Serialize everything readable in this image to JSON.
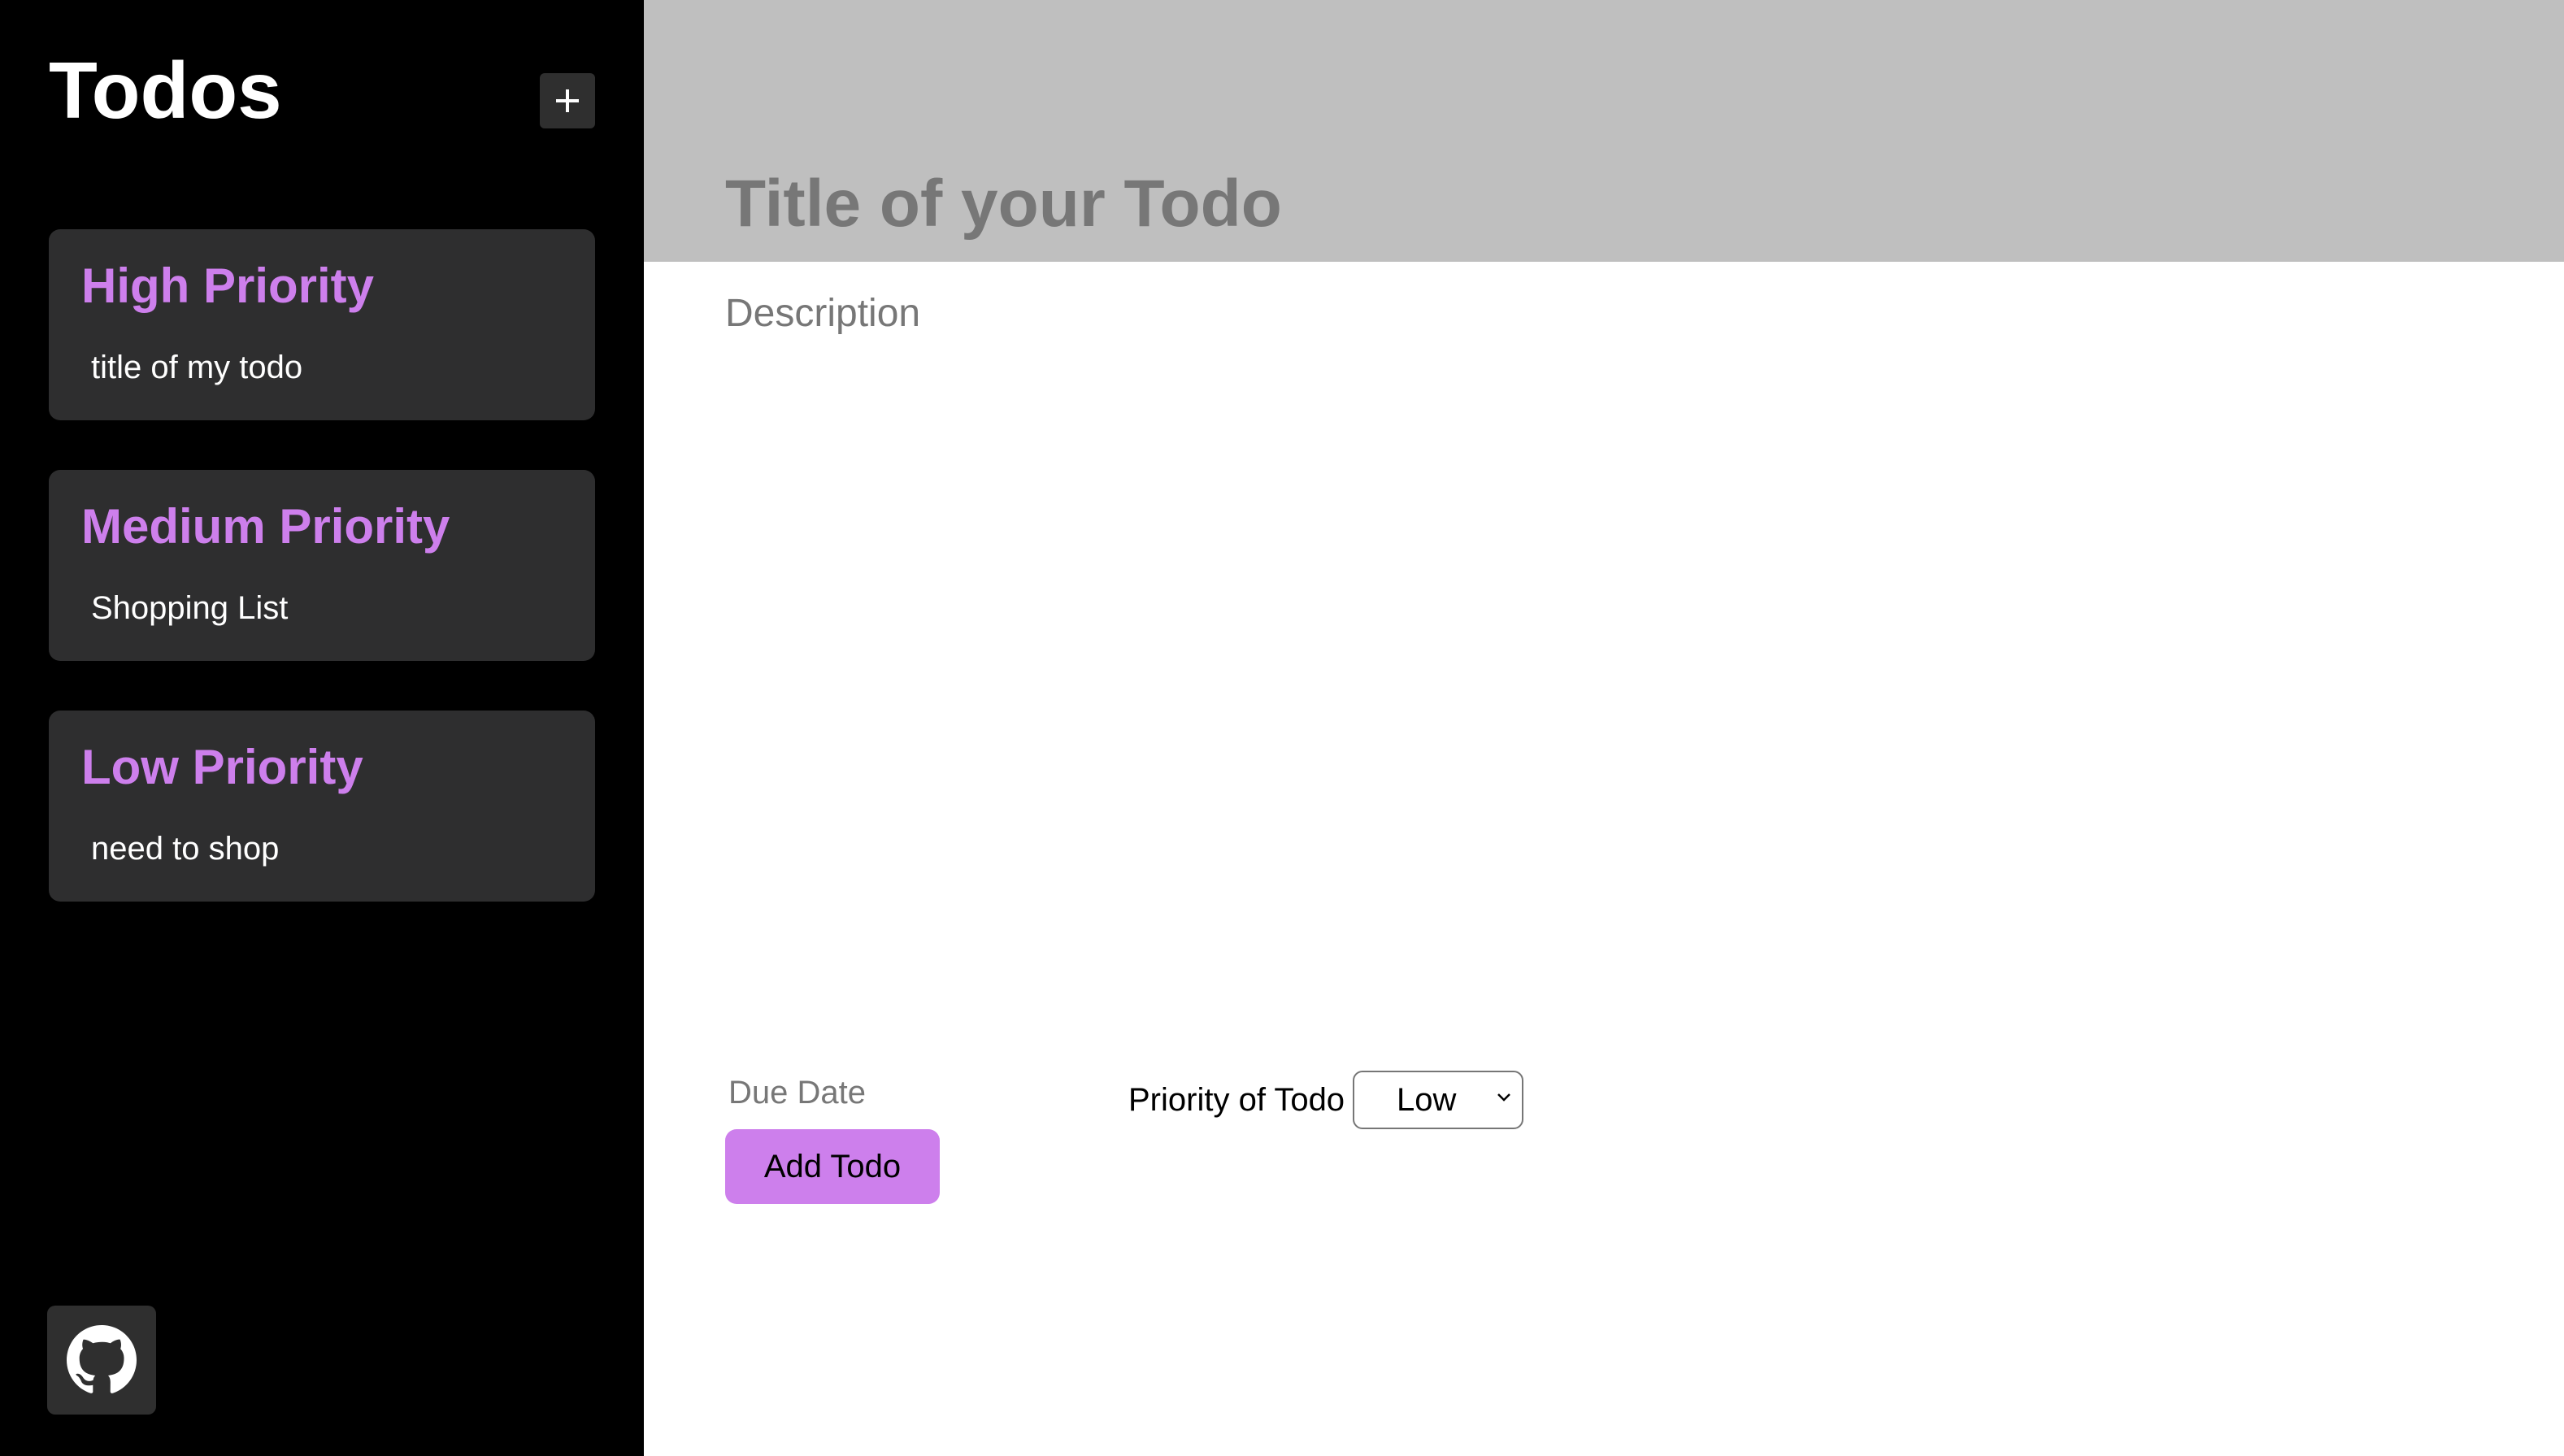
{
  "app": {
    "title": "Todos",
    "add_button_symbol": "+",
    "accent_color": "#cd7fec",
    "sidebar_background": "#000000",
    "card_background": "#2e2e2f"
  },
  "sidebar": {
    "groups": [
      {
        "title": "High Priority",
        "items": [
          "title of my todo"
        ]
      },
      {
        "title": "Medium Priority",
        "items": [
          "Shopping List"
        ]
      },
      {
        "title": "Low Priority",
        "items": [
          "need to shop"
        ]
      }
    ],
    "footer_icon": "github-icon"
  },
  "form": {
    "title_placeholder": "Title of your Todo",
    "description_placeholder": "Description",
    "due_date_label": "Due Date",
    "submit_label": "Add Todo",
    "priority_label": "Priority of Todo",
    "priority_selected": "Low"
  }
}
